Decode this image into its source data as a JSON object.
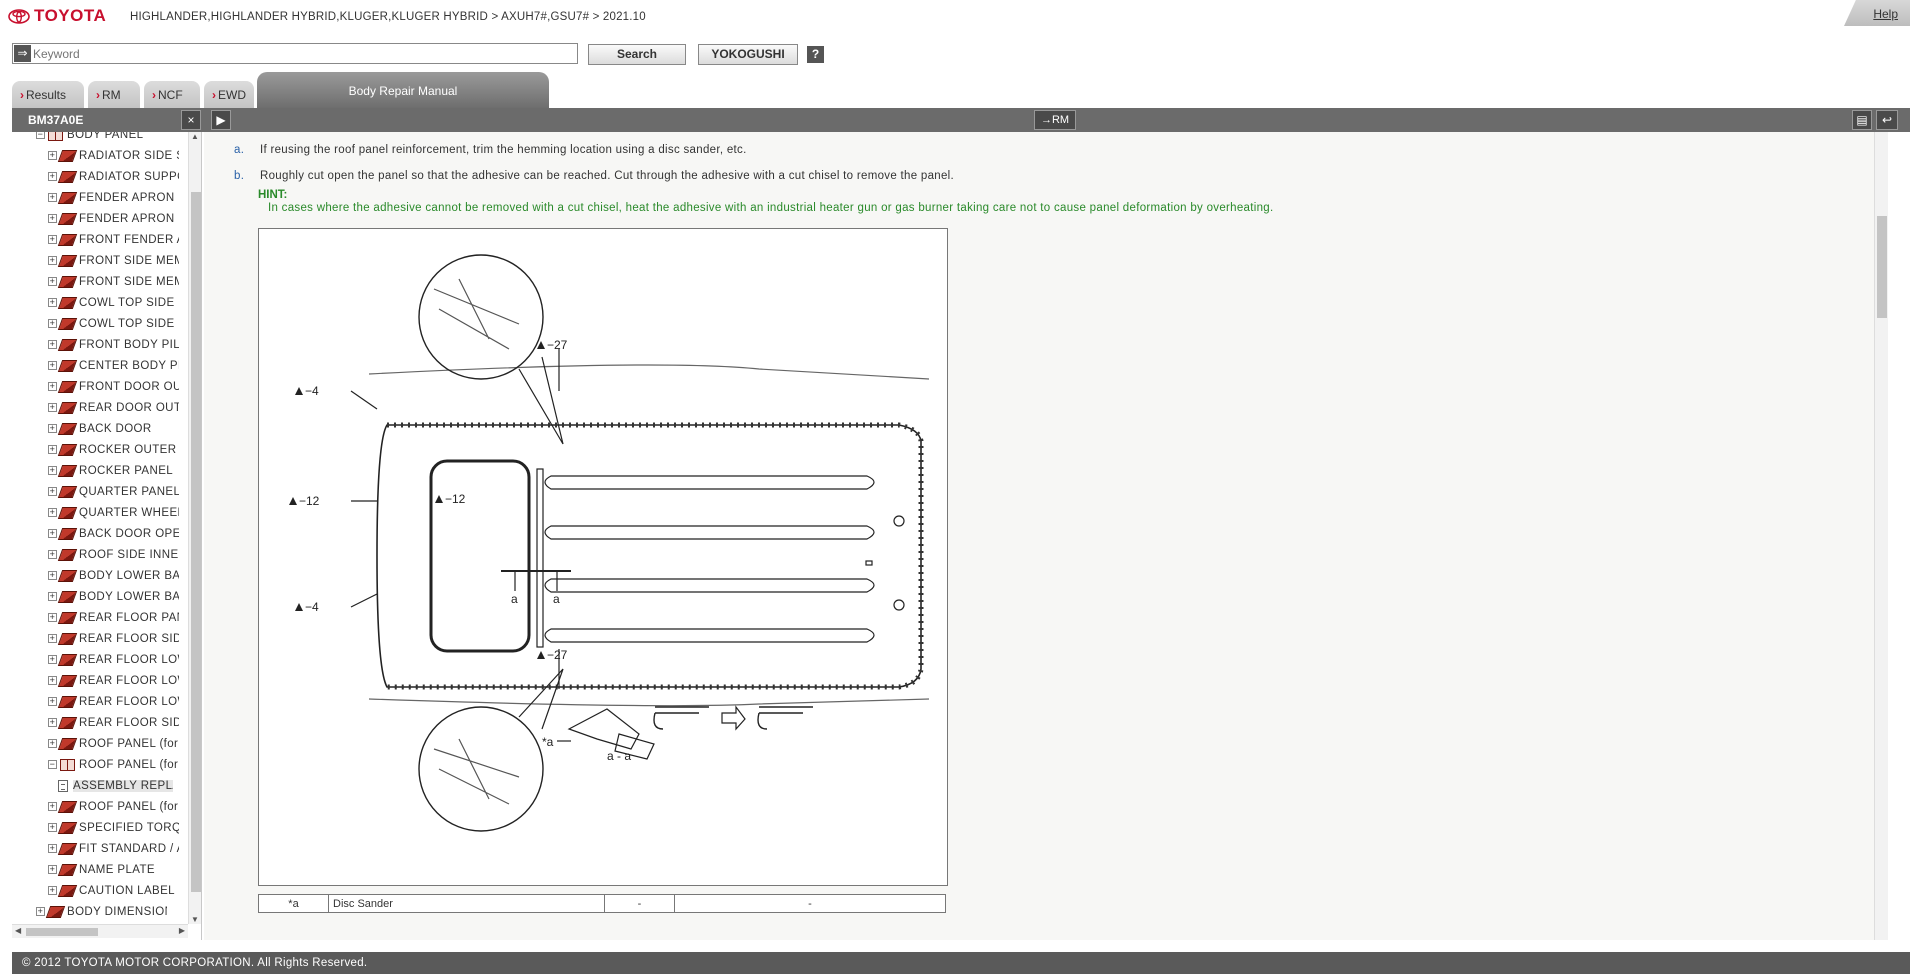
{
  "brand": "TOYOTA",
  "breadcrumb": "HIGHLANDER,HIGHLANDER HYBRID,KLUGER,KLUGER HYBRID > AXUH7#,GSU7# > 2021.10",
  "help_label": "Help",
  "search": {
    "placeholder": "Keyword",
    "value": "",
    "search_label": "Search",
    "yoko_label": "YOKOGUSHI",
    "question_label": "?"
  },
  "tabs": [
    {
      "label": "Results",
      "chev": "›"
    },
    {
      "label": "RM",
      "chev": "›"
    },
    {
      "label": "NCF",
      "chev": "›"
    },
    {
      "label": "EWD",
      "chev": "›"
    }
  ],
  "active_tab": "Body Repair Manual",
  "toolbar": {
    "doc_id": "BM37A0E",
    "close": "×",
    "arrow": "▶",
    "rm": "→RM",
    "print": "▤",
    "back": "↩"
  },
  "tree": [
    {
      "label": "BODY PANEL",
      "level": 0,
      "icon": "book-open",
      "pm": "−"
    },
    {
      "label": "RADIATOR SIDE SUPPORT",
      "level": 1,
      "icon": "book",
      "pm": "+"
    },
    {
      "label": "RADIATOR SUPPORT",
      "level": 1,
      "icon": "book",
      "pm": "+"
    },
    {
      "label": "FENDER APRON BRACE",
      "level": 1,
      "icon": "book",
      "pm": "+"
    },
    {
      "label": "FENDER APRON BAFFLE",
      "level": 1,
      "icon": "book",
      "pm": "+"
    },
    {
      "label": "FRONT FENDER APRON",
      "level": 1,
      "icon": "book",
      "pm": "+"
    },
    {
      "label": "FRONT SIDE MEMBER",
      "level": 1,
      "icon": "book",
      "pm": "+"
    },
    {
      "label": "FRONT SIDE MEMBER",
      "level": 1,
      "icon": "book",
      "pm": "+"
    },
    {
      "label": "COWL TOP SIDE UPPER",
      "level": 1,
      "icon": "book",
      "pm": "+"
    },
    {
      "label": "COWL TOP SIDE PANEL",
      "level": 1,
      "icon": "book",
      "pm": "+"
    },
    {
      "label": "FRONT BODY PILLAR",
      "level": 1,
      "icon": "book",
      "pm": "+"
    },
    {
      "label": "CENTER BODY PILLAR",
      "level": 1,
      "icon": "book",
      "pm": "+"
    },
    {
      "label": "FRONT DOOR OUTER",
      "level": 1,
      "icon": "book",
      "pm": "+"
    },
    {
      "label": "REAR DOOR OUTER",
      "level": 1,
      "icon": "book",
      "pm": "+"
    },
    {
      "label": "BACK DOOR",
      "level": 1,
      "icon": "book",
      "pm": "+"
    },
    {
      "label": "ROCKER OUTER PANEL",
      "level": 1,
      "icon": "book",
      "pm": "+"
    },
    {
      "label": "ROCKER PANEL",
      "level": 1,
      "icon": "book",
      "pm": "+"
    },
    {
      "label": "QUARTER PANEL",
      "level": 1,
      "icon": "book",
      "pm": "+"
    },
    {
      "label": "QUARTER WHEEL",
      "level": 1,
      "icon": "book",
      "pm": "+"
    },
    {
      "label": "BACK DOOR OPENING",
      "level": 1,
      "icon": "book",
      "pm": "+"
    },
    {
      "label": "ROOF SIDE INNER",
      "level": 1,
      "icon": "book",
      "pm": "+"
    },
    {
      "label": "BODY LOWER BACK",
      "level": 1,
      "icon": "book",
      "pm": "+"
    },
    {
      "label": "BODY LOWER BACK",
      "level": 1,
      "icon": "book",
      "pm": "+"
    },
    {
      "label": "REAR FLOOR PAN",
      "level": 1,
      "icon": "book",
      "pm": "+"
    },
    {
      "label": "REAR FLOOR SIDE",
      "level": 1,
      "icon": "book",
      "pm": "+"
    },
    {
      "label": "REAR FLOOR LOWER",
      "level": 1,
      "icon": "book",
      "pm": "+"
    },
    {
      "label": "REAR FLOOR LOWER",
      "level": 1,
      "icon": "book",
      "pm": "+"
    },
    {
      "label": "REAR FLOOR LOWER",
      "level": 1,
      "icon": "book",
      "pm": "+"
    },
    {
      "label": "REAR FLOOR SIDE",
      "level": 1,
      "icon": "book",
      "pm": "+"
    },
    {
      "label": "ROOF PANEL (for",
      "level": 1,
      "icon": "book",
      "pm": "+"
    },
    {
      "label": "ROOF PANEL (for",
      "level": 1,
      "icon": "book-open",
      "pm": "−"
    },
    {
      "label": "ASSEMBLY REPLACEMENT",
      "level": 2,
      "icon": "doc",
      "pm": "",
      "selected": true
    },
    {
      "label": "ROOF PANEL (for",
      "level": 1,
      "icon": "book",
      "pm": "+"
    },
    {
      "label": "SPECIFIED TORQUE",
      "level": 1,
      "icon": "book",
      "pm": "+"
    },
    {
      "label": "FIT STANDARD / ADJUSTMENT",
      "level": 1,
      "icon": "book",
      "pm": "+"
    },
    {
      "label": "NAME PLATE",
      "level": 1,
      "icon": "book",
      "pm": "+"
    },
    {
      "label": "CAUTION LABEL",
      "level": 1,
      "icon": "book",
      "pm": "+"
    },
    {
      "label": "BODY DIMENSIONS",
      "level": 0,
      "icon": "book",
      "pm": "+"
    }
  ],
  "content": {
    "step_a_marker": "a.",
    "step_a": "If reusing the roof panel reinforcement, trim the hemming location using a disc sander, etc.",
    "step_b_marker": "b.",
    "step_b": "Roughly cut open the panel so that the adhesive can be reached. Cut through the adhesive with a cut chisel to remove the panel.",
    "hint_title": "HINT:",
    "hint_text": "In cases where the adhesive cannot be removed with a cut chisel, heat the adhesive with an industrial heater gun or gas burner taking care not to cause panel deformation by overheating."
  },
  "figure": {
    "callout_top": "−27",
    "callout_bottom": "−27",
    "callout_left_top": "−4",
    "callout_left_mid": "−12",
    "callout_left_bot": "−4",
    "callout_inner": "−12",
    "section_mark": "a",
    "section_label": "a - a",
    "tool_label": "*a"
  },
  "legend": {
    "code": "*a",
    "name": "Disc Sander",
    "col3": "-",
    "col4": "-"
  },
  "footer": "© 2012 TOYOTA MOTOR CORPORATION. All Rights Reserved.",
  "colors": {
    "brand_red": "#c8102e",
    "hint_green": "#2a8a2a",
    "step_blue": "#2b62a8",
    "toolbar_gray": "#6b6b6b"
  }
}
